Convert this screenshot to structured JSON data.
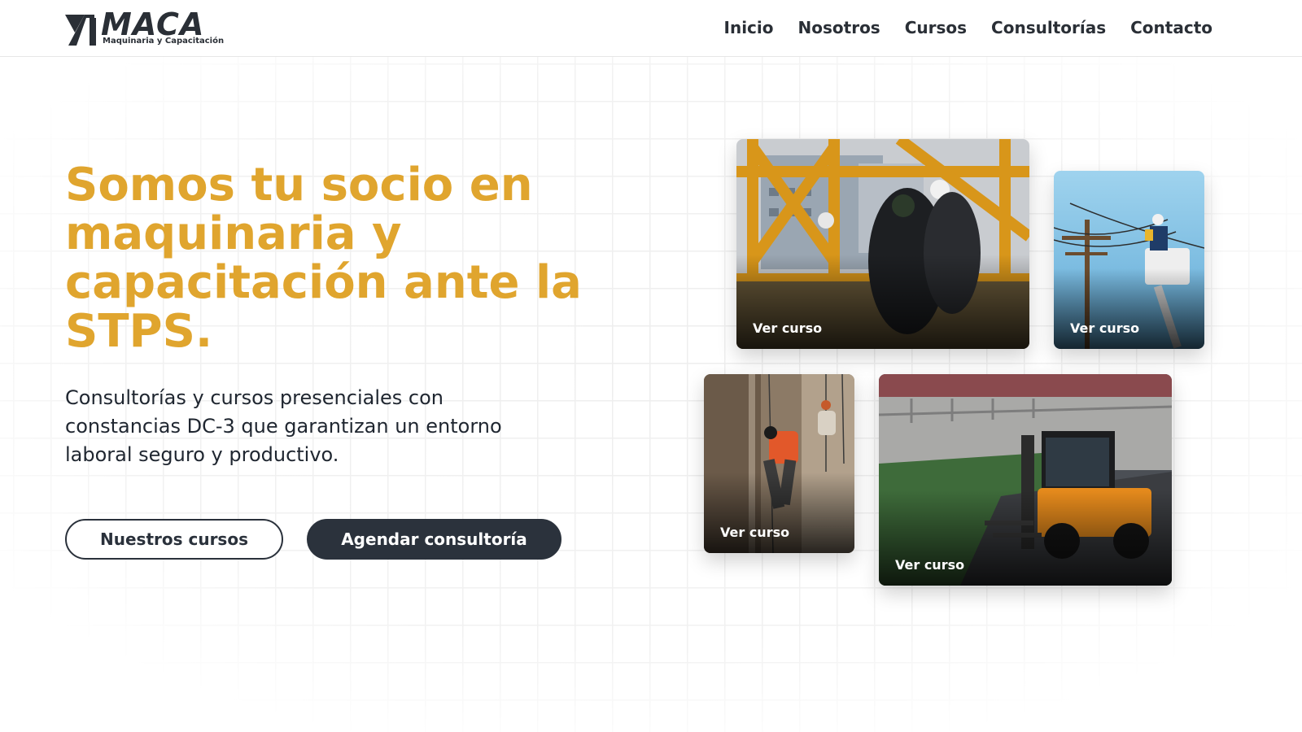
{
  "brand": {
    "name": "MACA",
    "tagline": "Maquinaria y Capacitación"
  },
  "nav": {
    "items": [
      "Inicio",
      "Nosotros",
      "Cursos",
      "Consultorías",
      "Contacto"
    ]
  },
  "hero": {
    "title": "Somos tu socio en maquinaria y capacitación ante la STPS.",
    "description": "Consultorías y cursos presenciales con constancias DC-3 que garantizan un entorno laboral seguro y productivo.",
    "primary_button": "Nuestros cursos",
    "secondary_button": "Agendar consultoría"
  },
  "courses": [
    {
      "label": "Ver curso",
      "image": "crane-workers-photo"
    },
    {
      "label": "Ver curso",
      "image": "lineman-bucket-truck-photo"
    },
    {
      "label": "Ver curso",
      "image": "rope-access-workers-photo"
    },
    {
      "label": "Ver curso",
      "image": "forklift-photo"
    }
  ],
  "colors": {
    "accent": "#e0a52e",
    "dark": "#2b323c",
    "text": "#1f2630"
  }
}
